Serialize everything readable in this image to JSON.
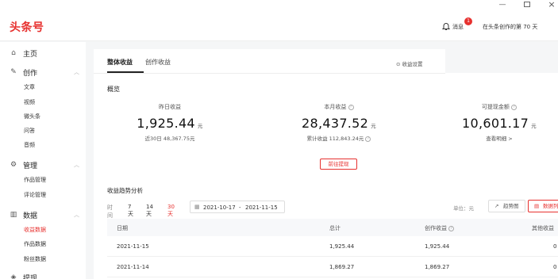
{
  "header": {
    "logo": "头条号",
    "notifications_count": "1",
    "messages_label": "消息",
    "days_label": "在头条创作的第 70 天"
  },
  "sidebar": {
    "items": [
      {
        "label": "主页",
        "icon": "home-icon"
      },
      {
        "label": "创作",
        "icon": "pen-icon",
        "children": [
          "文章",
          "视频",
          "微头条",
          "问答",
          "音频"
        ]
      },
      {
        "label": "管理",
        "icon": "gear-icon",
        "children": [
          "作品管理",
          "评论管理"
        ]
      },
      {
        "label": "数据",
        "icon": "chart-icon",
        "children": [
          "收益数据",
          "作品数据",
          "粉丝数据"
        ]
      },
      {
        "label": "提现",
        "icon": "wallet-icon"
      }
    ],
    "active_sub": "收益数据"
  },
  "tabs": [
    "整体收益",
    "创作收益"
  ],
  "settings_label": "收益设置",
  "overview_title": "概览",
  "stats": [
    {
      "label": "昨日收益",
      "value": "1,925.44",
      "unit": "元",
      "sub": "近30日 48,367.75元"
    },
    {
      "label": "本月收益",
      "value": "28,437.52",
      "unit": "元",
      "sub": "累计收益 112,843.24元"
    },
    {
      "label": "可提现金额",
      "value": "10,601.17",
      "unit": "元",
      "sub": "查看明细 >"
    }
  ],
  "withdraw_button": "前往提现",
  "trend": {
    "title": "收益趋势分析",
    "filter_label": "时间",
    "ranges": [
      "7天",
      "14天",
      "30天"
    ],
    "active_range": "30天",
    "date_start": "2021-10-17",
    "date_sep": "-",
    "date_end": "2021-11-15",
    "unit_label": "单位：元",
    "chart_button": "趋势图",
    "list_button": "数据列"
  },
  "table": {
    "columns": [
      "日期",
      "总计",
      "创作收益",
      "其他收益"
    ],
    "rows": [
      [
        "2021-11-15",
        "1,925.44",
        "1,925.44",
        "0"
      ],
      [
        "2021-11-14",
        "1,869.27",
        "1,869.27",
        "0"
      ]
    ]
  },
  "colors": {
    "brand": "#e7312f",
    "background": "#f5f6f7"
  }
}
